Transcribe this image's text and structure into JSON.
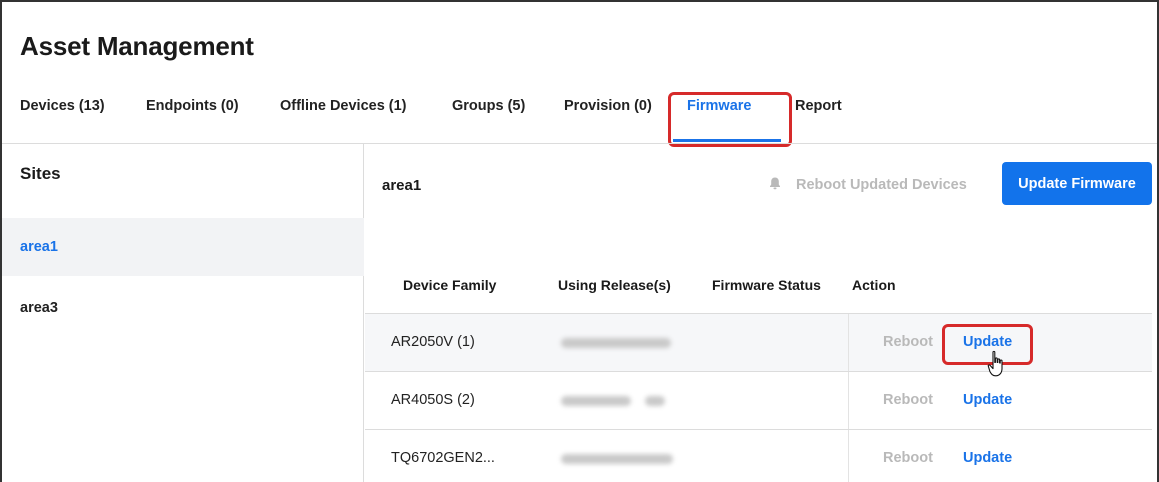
{
  "app": {
    "title": "Asset Management"
  },
  "tabs": [
    {
      "label": "Devices (13)"
    },
    {
      "label": "Endpoints (0)"
    },
    {
      "label": "Offline Devices (1)"
    },
    {
      "label": "Groups (5)"
    },
    {
      "label": "Provision (0)"
    },
    {
      "label": "Firmware",
      "active": true
    },
    {
      "label": "Report"
    }
  ],
  "sidebar": {
    "title": "Sites",
    "items": [
      {
        "label": "area1",
        "selected": true
      },
      {
        "label": "area3"
      }
    ]
  },
  "main": {
    "area_title": "area1",
    "reboot_updated_label": "Reboot Updated Devices",
    "update_firmware_label": "Update Firmware",
    "columns": [
      "Device Family",
      "Using Release(s)",
      "Firmware Status",
      "Action"
    ],
    "rows": [
      {
        "family": "AR2050V (1)",
        "reboot": "Reboot",
        "update": "Update"
      },
      {
        "family": "AR4050S (2)",
        "reboot": "Reboot",
        "update": "Update"
      },
      {
        "family": "TQ6702GEN2...",
        "reboot": "Reboot",
        "update": "Update"
      }
    ]
  },
  "icons": {
    "reboot_updated": "bell-icon",
    "cursor": "hand-pointer-icon"
  },
  "colors": {
    "accent": "#1a73e8",
    "highlight": "#d62a2a",
    "disabled": "#b9b9b9"
  }
}
